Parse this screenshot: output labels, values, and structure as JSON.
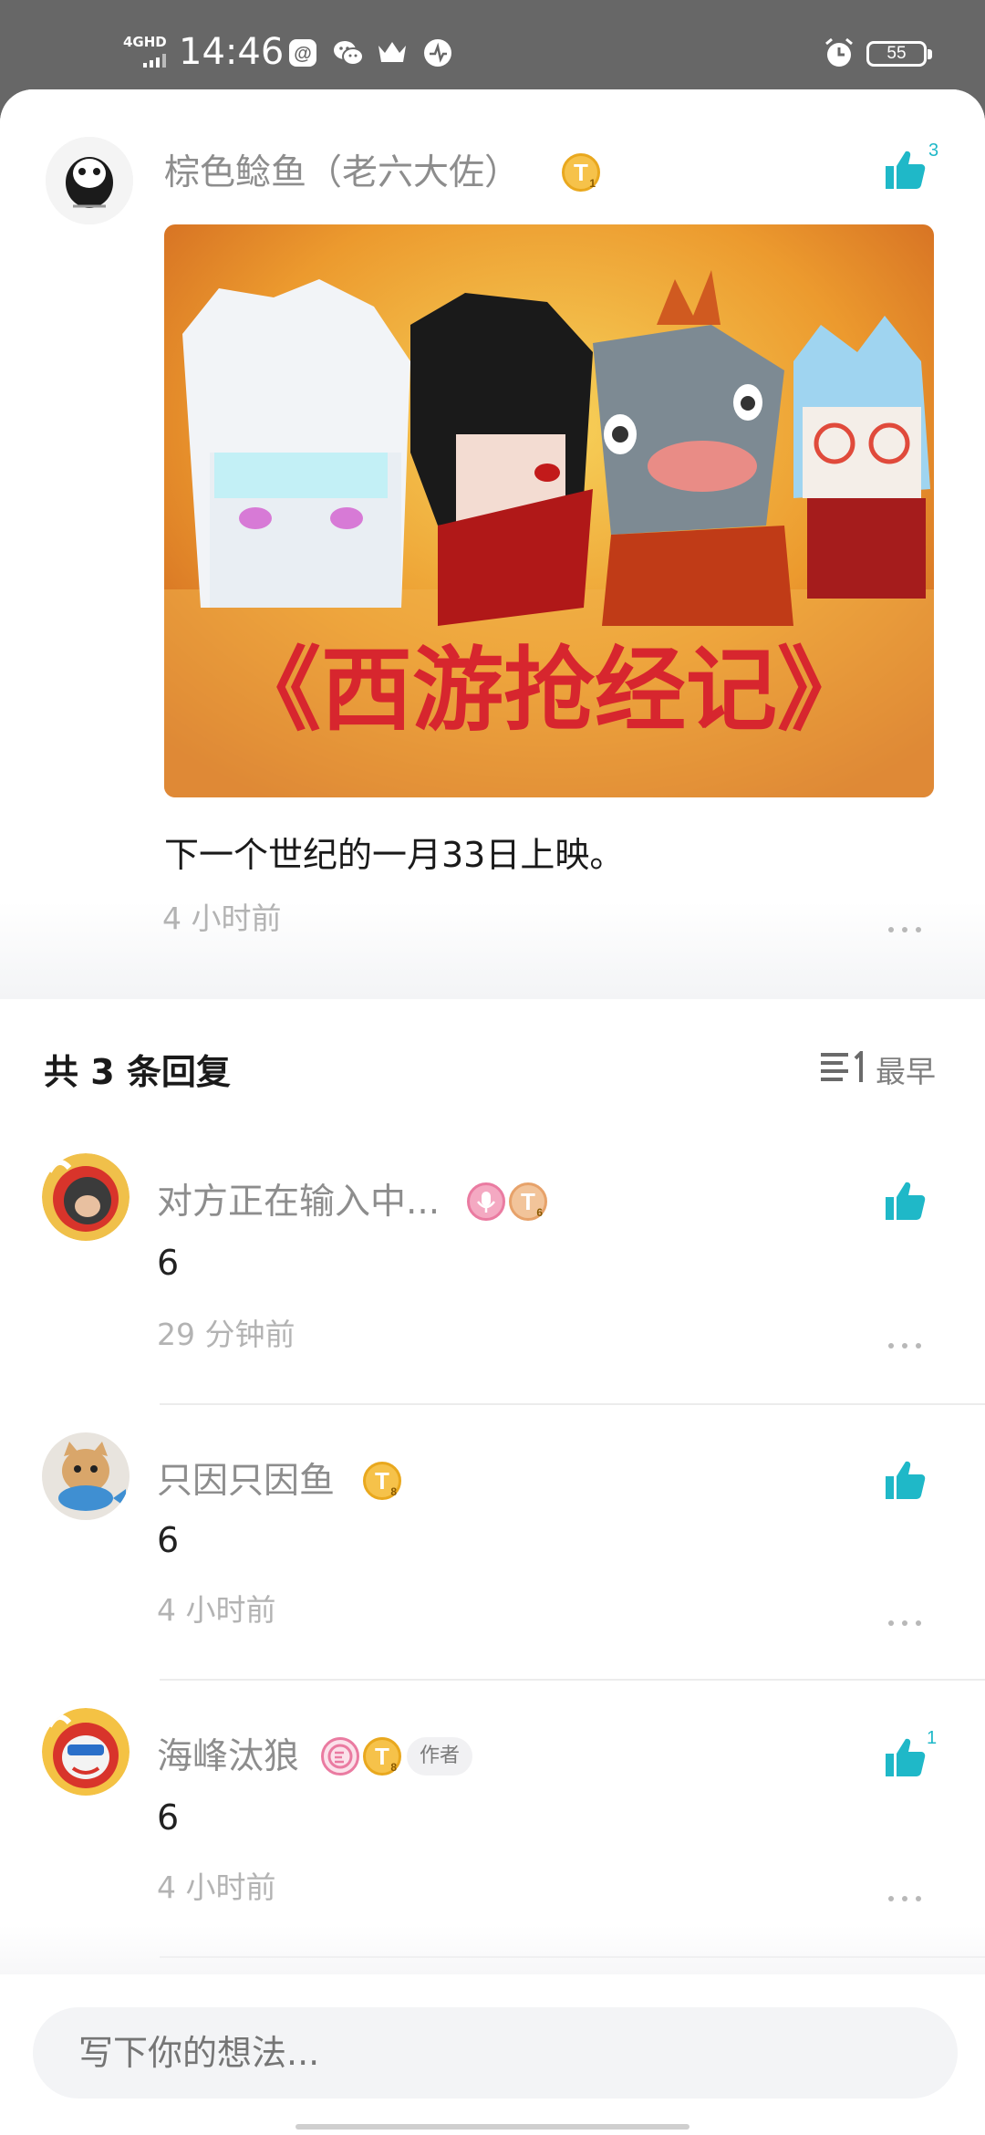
{
  "status_bar": {
    "network": "4GHD",
    "time": "14:46",
    "battery": "55"
  },
  "post": {
    "username": "棕色鲶鱼（老六大佐）",
    "badge": "T",
    "badge_level": "1",
    "like_count": "3",
    "image_caption": "《西游抢经记》",
    "text": "下一个世纪的一月33日上映。",
    "time": "4 小时前"
  },
  "replies_header": {
    "title": "共 3 条回复",
    "sort_label": "最早"
  },
  "replies": [
    {
      "username": "对方正在输入中...",
      "badge": "T",
      "badge_level": "6",
      "content": "6",
      "time": "29 分钟前",
      "like_count": ""
    },
    {
      "username": "只因只因鱼",
      "badge": "T",
      "badge_level": "8",
      "content": "6",
      "time": "4 小时前",
      "like_count": ""
    },
    {
      "username": "海峰汰狼",
      "badge": "T",
      "badge_level": "8",
      "author_tag": "作者",
      "content": "6",
      "time": "4 小时前",
      "like_count": "1"
    }
  ],
  "comment_input": {
    "placeholder": "写下你的想法..."
  },
  "colors": {
    "accent": "#1fb8c8",
    "status_bar_bg": "#676767",
    "gold_badge": "#f6c24a"
  }
}
